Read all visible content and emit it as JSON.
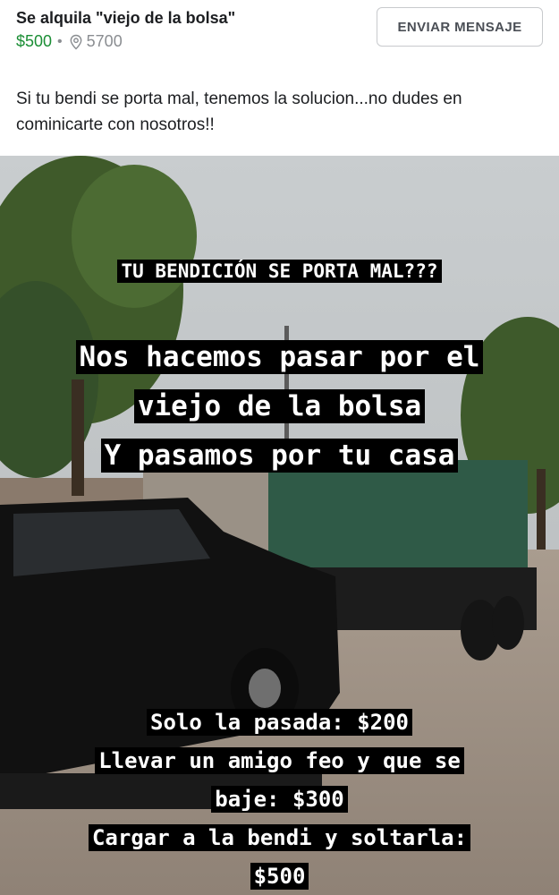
{
  "listing": {
    "title": "Se alquila \"viejo de la bolsa\"",
    "price": "$500",
    "separator": "•",
    "location_icon": "location-pin-icon",
    "zip": "5700",
    "send_button": "ENVIAR MENSAJE",
    "description": "Si tu bendi se porta mal, tenemos la solucion...no dudes en cominicarte con nosotros!!"
  },
  "photo": {
    "headline": "TU BENDICIÓN SE PORTA MAL???",
    "pitch": [
      "Nos hacemos pasar por el",
      "viejo de la bolsa",
      "Y pasamos por tu casa"
    ],
    "prices": [
      "Solo la pasada: $200",
      "Llevar un amigo feo y que se",
      "baje: $300",
      "Cargar a la bendi y soltarla:",
      "$500"
    ]
  },
  "colors": {
    "price_green": "#1b8e35",
    "text_dark": "#1c1e21",
    "muted_gray": "#8a8d91",
    "button_border": "#c8cacd",
    "caption_bg": "#000000",
    "caption_text": "#ffffff"
  }
}
